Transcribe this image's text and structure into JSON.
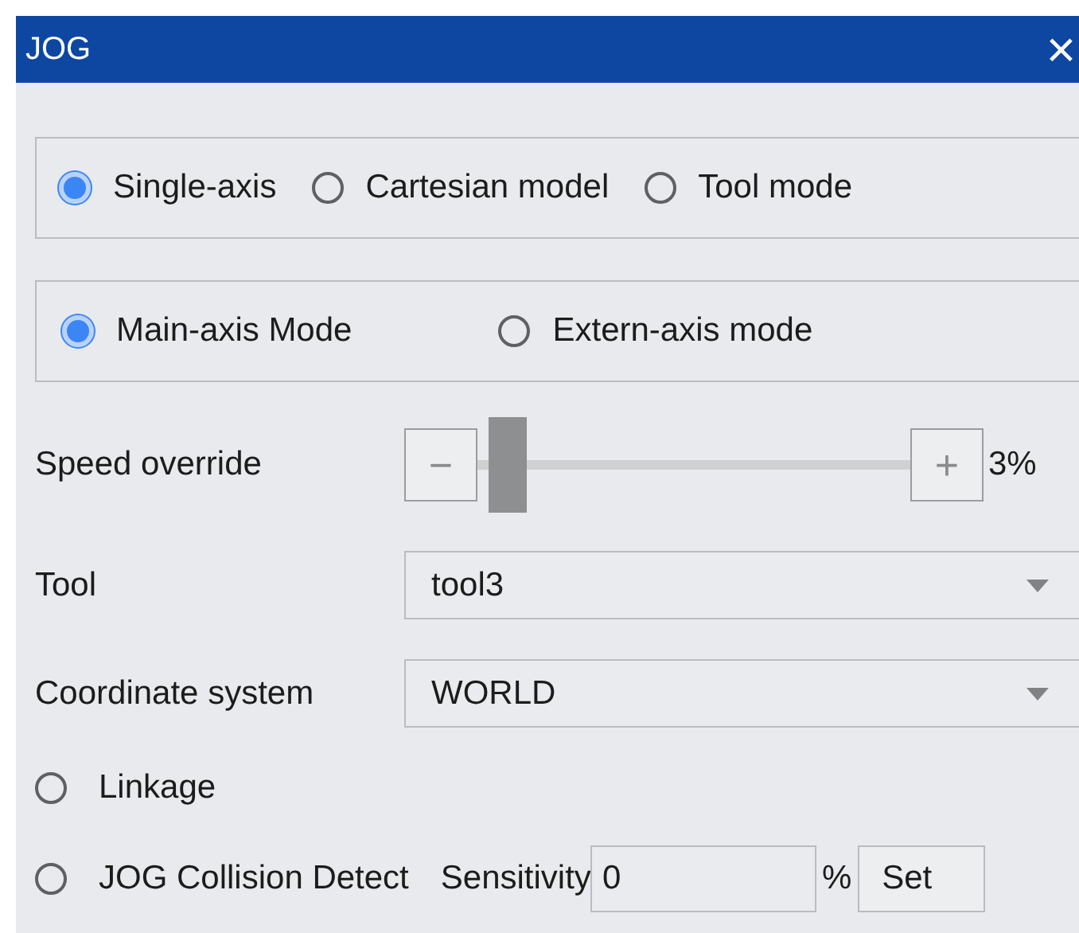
{
  "window": {
    "title": "JOG",
    "close": "×"
  },
  "motion_modes": [
    {
      "label": "Single-axis",
      "selected": true
    },
    {
      "label": "Cartesian model",
      "selected": false
    },
    {
      "label": "Tool mode",
      "selected": false
    }
  ],
  "axis_modes": [
    {
      "label": "Main-axis Mode",
      "selected": true
    },
    {
      "label": "Extern-axis mode",
      "selected": false
    }
  ],
  "speed": {
    "label": "Speed override",
    "minus": "−",
    "plus": "+",
    "level": 0.03,
    "reading": "3%"
  },
  "tool": {
    "label": "Tool",
    "value": "tool3"
  },
  "coordinate_system": {
    "label": "Coordinate system",
    "value": "WORLD"
  },
  "linkage": {
    "label": "Linkage",
    "checked": false
  },
  "collision": {
    "label": "JOG Collision Detect",
    "checked": false,
    "sensitivity_label": "Sensitivity",
    "value": "0",
    "unit": "%",
    "button": "Set"
  }
}
